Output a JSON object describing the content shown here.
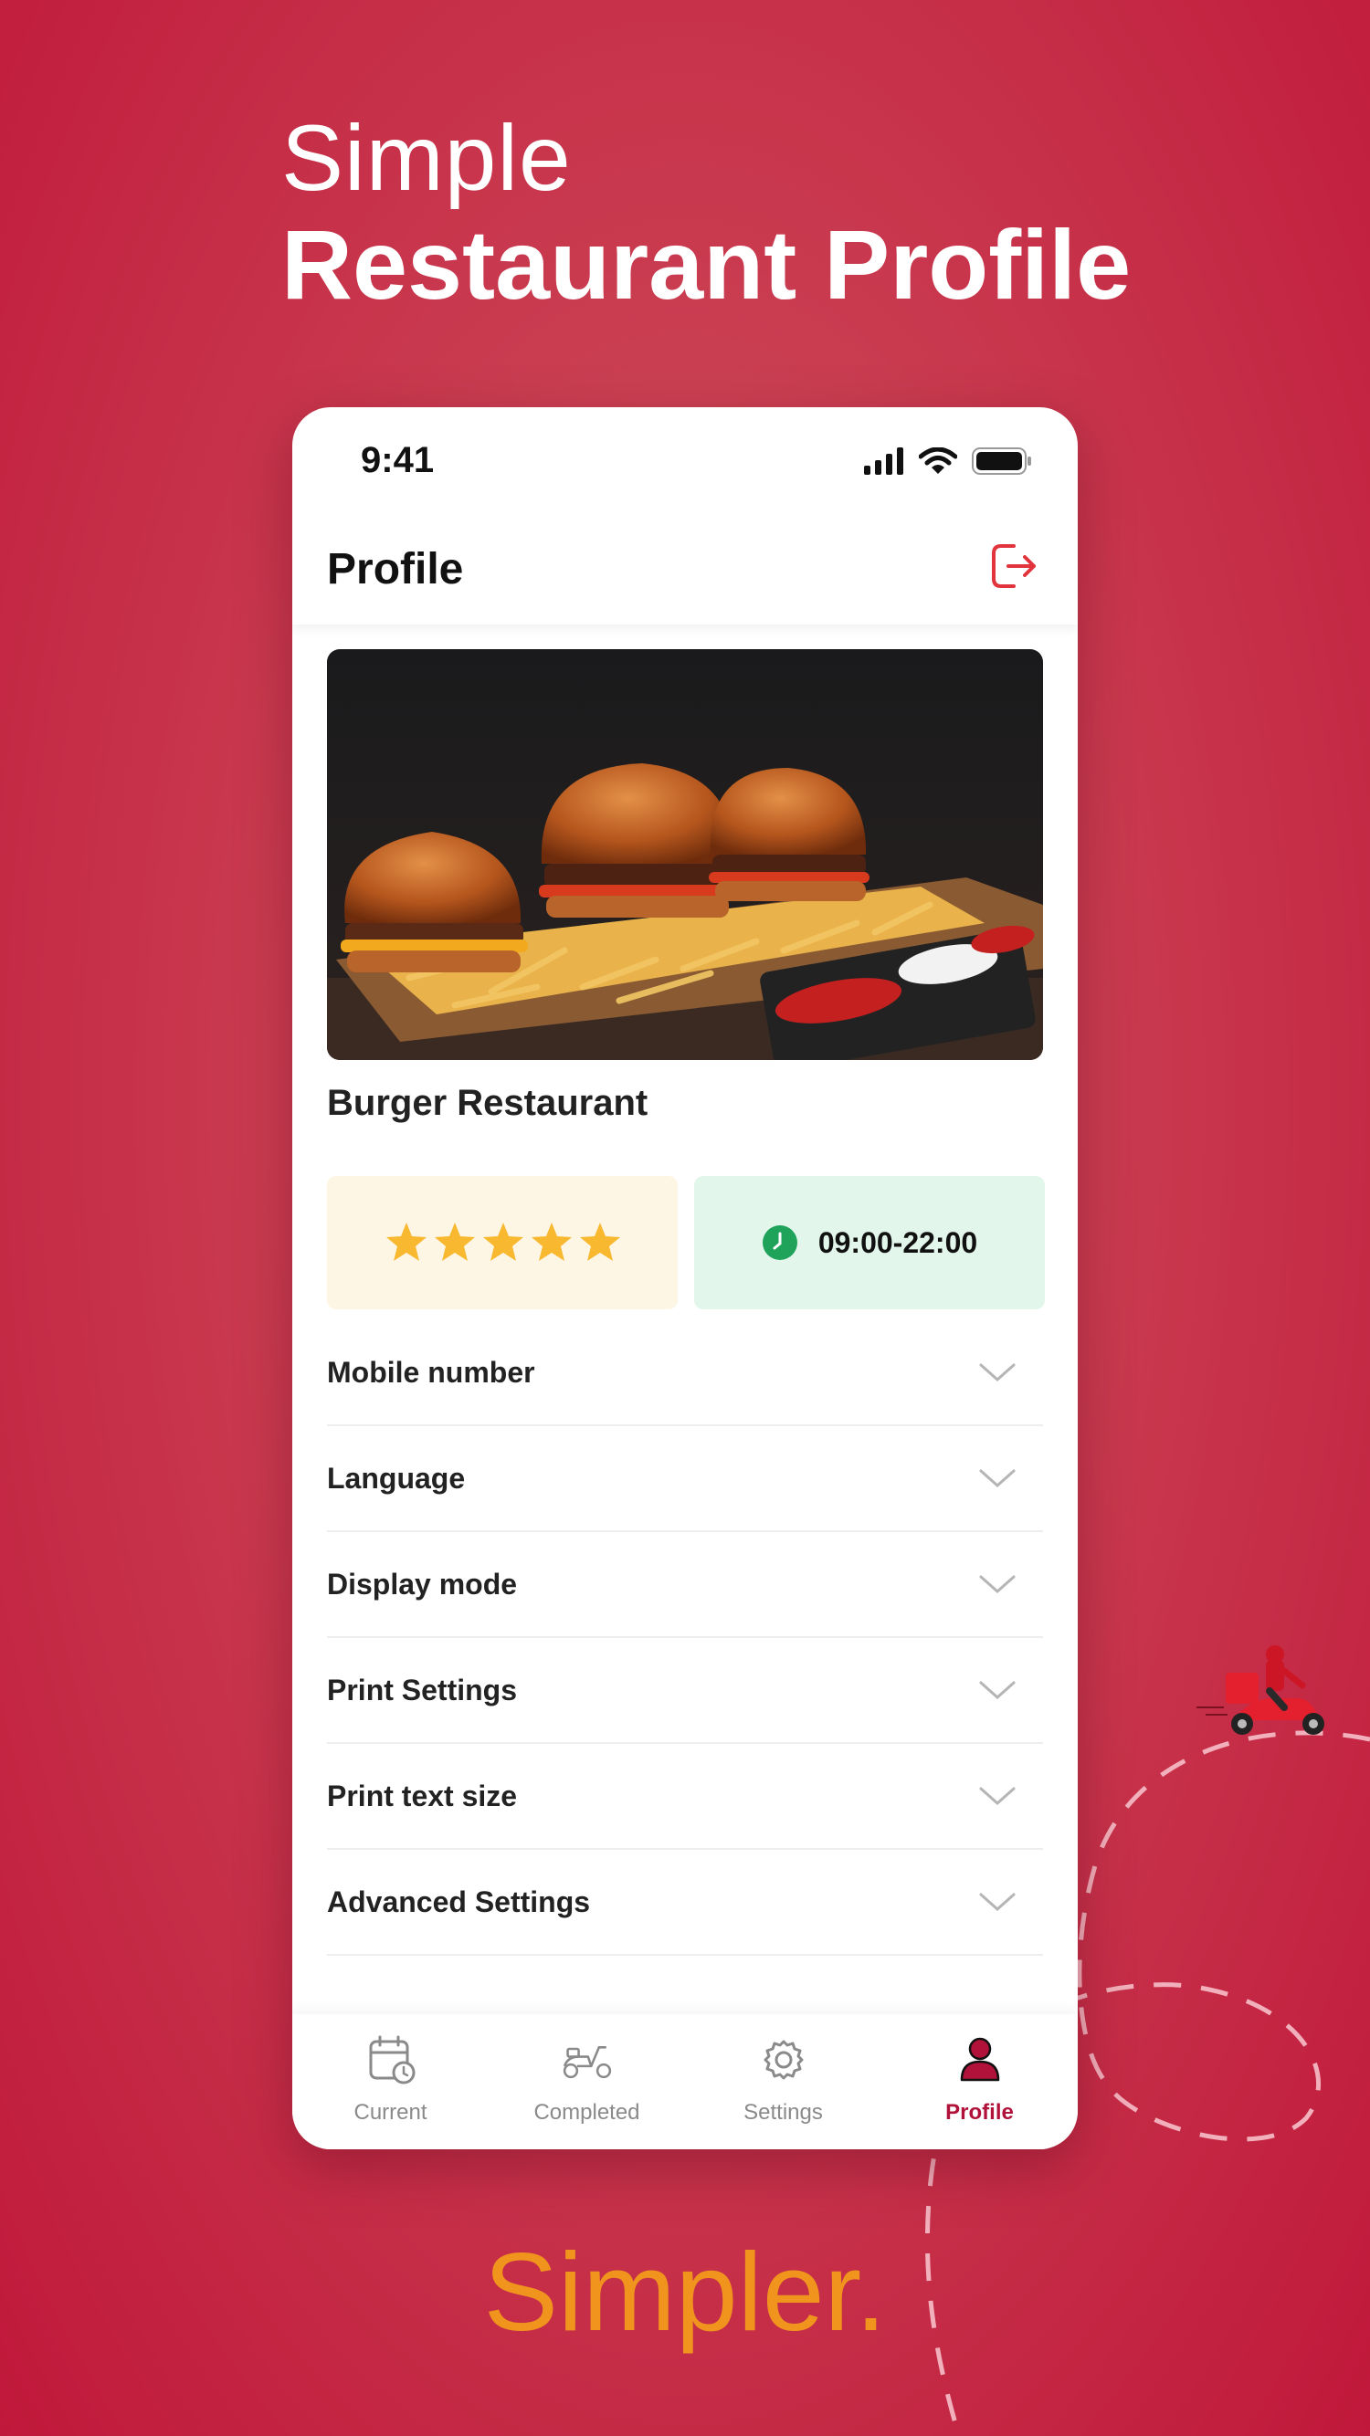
{
  "headline": {
    "line1": "Simple",
    "line2": "Restaurant Profile"
  },
  "tagline": "Simpler.",
  "status_bar": {
    "time": "9:41"
  },
  "appbar": {
    "title": "Profile",
    "logout_icon": "logout-icon"
  },
  "restaurant": {
    "name": "Burger Restaurant",
    "rating_stars": 5,
    "hours": "09:00-22:00"
  },
  "settings": [
    {
      "label": "Mobile number"
    },
    {
      "label": "Language"
    },
    {
      "label": "Display mode"
    },
    {
      "label": "Print Settings"
    },
    {
      "label": "Print text size"
    },
    {
      "label": "Advanced Settings"
    }
  ],
  "tabs": [
    {
      "label": "Current",
      "icon": "calendar-clock-icon"
    },
    {
      "label": "Completed",
      "icon": "scooter-icon"
    },
    {
      "label": "Settings",
      "icon": "gear-icon"
    },
    {
      "label": "Profile",
      "icon": "person-icon",
      "active": true
    }
  ],
  "colors": {
    "brand": "#c0183a",
    "accent": "#f0941e",
    "star": "#f8b830",
    "clock": "#1fa35a"
  }
}
